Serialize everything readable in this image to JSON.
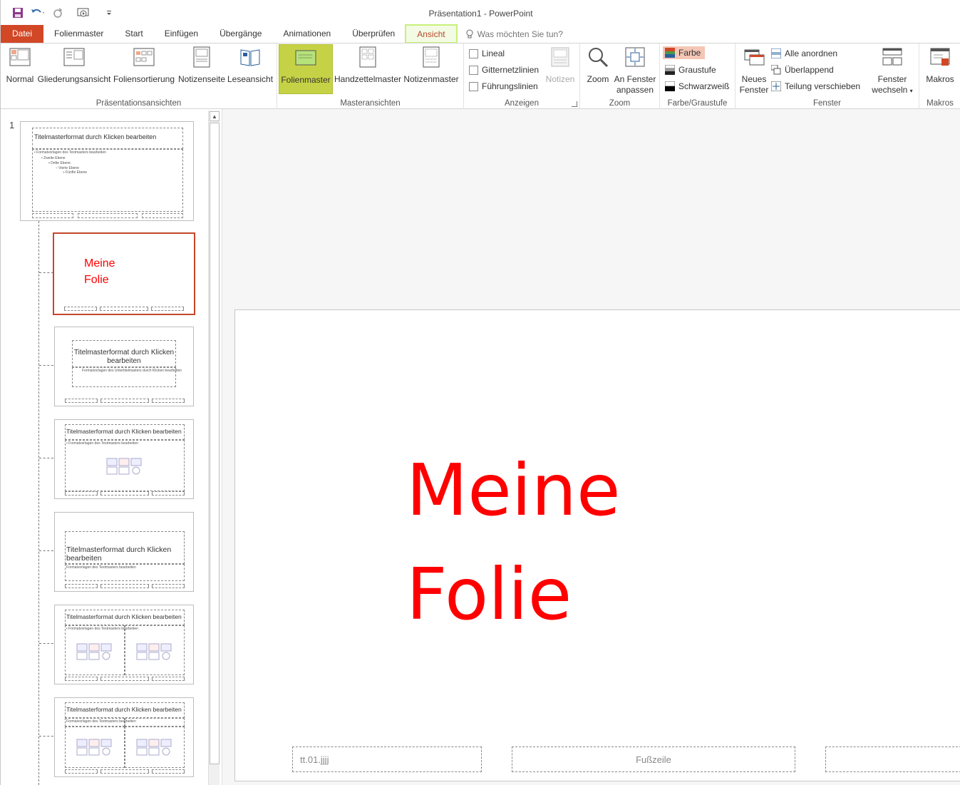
{
  "window": {
    "title": "Präsentation1  -  PowerPoint"
  },
  "qat": {
    "save_icon": "save-icon",
    "undo_icon": "undo-icon",
    "redo_icon": "redo-icon",
    "present_icon": "start-presentation-icon"
  },
  "tabs": [
    {
      "label": "Datei"
    },
    {
      "label": "Folienmaster"
    },
    {
      "label": "Start"
    },
    {
      "label": "Einfügen"
    },
    {
      "label": "Übergänge"
    },
    {
      "label": "Animationen"
    },
    {
      "label": "Überprüfen"
    },
    {
      "label": "Ansicht"
    }
  ],
  "tellme": {
    "placeholder": "Was möchten Sie tun?"
  },
  "ribbon": {
    "presentation_views": {
      "label": "Präsentationsansichten",
      "buttons": [
        "Normal",
        "Gliederungsansicht",
        "Foliensortierung",
        "Notizenseite",
        "Leseansicht"
      ]
    },
    "master_views": {
      "label": "Masteransichten",
      "buttons": [
        "Folienmaster",
        "Handzettelmaster",
        "Notizenmaster"
      ]
    },
    "show": {
      "label": "Anzeigen",
      "checks": [
        "Lineal",
        "Gitternetzlinien",
        "Führungslinien"
      ],
      "notes": "Notizen"
    },
    "zoom": {
      "label": "Zoom",
      "zoom": "Zoom",
      "fit_line1": "An Fenster",
      "fit_line2": "anpassen"
    },
    "color": {
      "label": "Farbe/Graustufe",
      "items": [
        "Farbe",
        "Graustufe",
        "Schwarzweiß"
      ],
      "accent": "#f4c6b5"
    },
    "window": {
      "label": "Fenster",
      "new_line1": "Neues",
      "new_line2": "Fenster",
      "items": [
        "Alle anordnen",
        "Überlappend",
        "Teilung verschieben"
      ],
      "switch_line1": "Fenster",
      "switch_line2": "wechseln"
    },
    "macros": {
      "label": "Makros",
      "button": "Makros"
    }
  },
  "thumbnails": {
    "number": "1",
    "master": {
      "title": "Titelmasterformat durch Klicken bearbeiten",
      "body": "• Formatvorlagen des Textmasters bearbeiten",
      "level2": "• Zweite Ebene",
      "level3": "• Dritte Ebene",
      "level4": "– Vierte Ebene",
      "level5": "» Fünfte Ebene"
    },
    "title_slide": {
      "title": "Meine Folie"
    },
    "section": {
      "title": "Titelmasterformat durch Klicken bearbeiten",
      "sub": "Formatvorlagen des Untertitelmasters durch Klicken bearbeiten"
    },
    "content": {
      "title": "Titelmasterformat durch Klicken bearbeiten",
      "body": "• Formatvorlagen des Textmasters bearbeiten"
    },
    "section_header": {
      "title": "Titelmasterformat durch Klicken bearbeiten",
      "sub": "Formatvorlagen des Textmasters bearbeiten"
    },
    "two_content": {
      "title": "Titelmasterformat durch Klicken bearbeiten",
      "body": "• Formatvorlagen des Textmasters bearbeiten"
    },
    "comparison": {
      "title": "Titelmasterformat durch Klicken bearbeiten",
      "body": "Formatvorlagen des Textmasters bearbeiten"
    }
  },
  "slide": {
    "title_line1": "Meine",
    "title_line2": "Folie",
    "date": "tt.01.jjjj",
    "footer": "Fußzeile",
    "title_color": "#ff0000"
  }
}
